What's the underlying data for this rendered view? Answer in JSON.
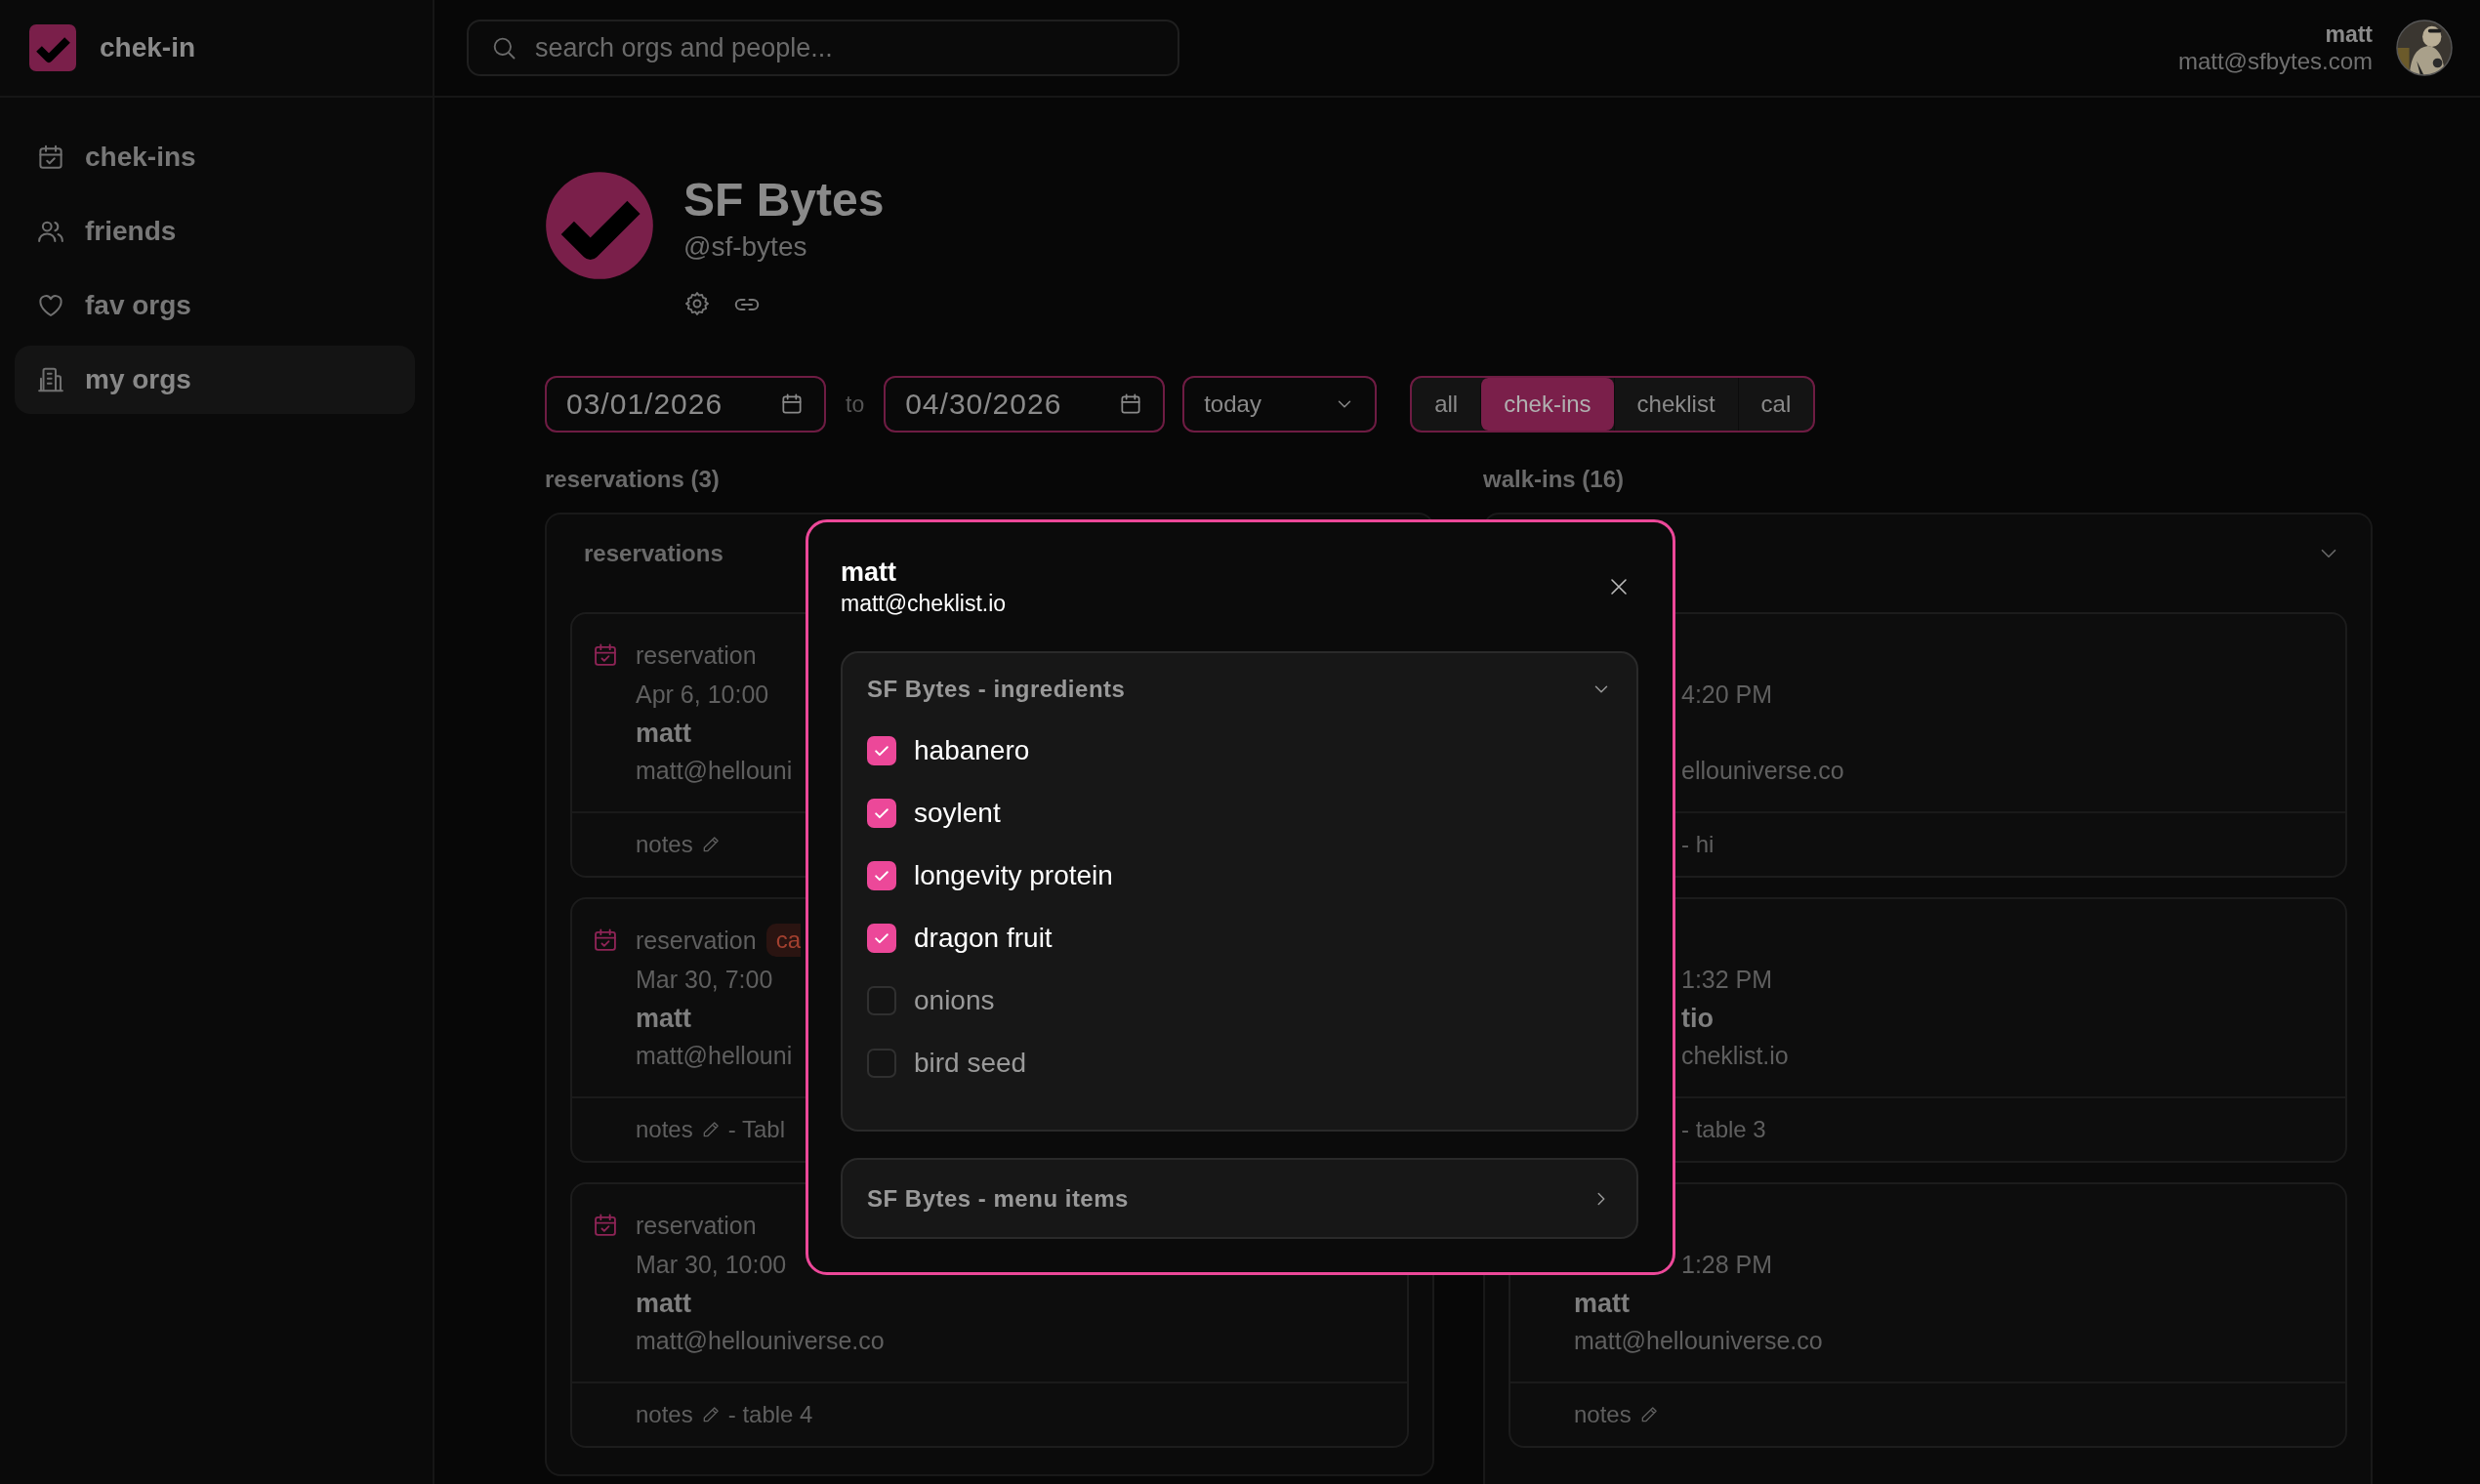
{
  "app": {
    "name": "chek-in"
  },
  "search": {
    "placeholder": "search orgs and people..."
  },
  "user": {
    "name": "matt",
    "email": "matt@sfbytes.com"
  },
  "sidebar": {
    "items": [
      {
        "label": "chek-ins",
        "kind": "calendar",
        "selected": false
      },
      {
        "label": "friends",
        "kind": "people",
        "selected": false
      },
      {
        "label": "fav orgs",
        "kind": "heart",
        "selected": false
      },
      {
        "label": "my orgs",
        "kind": "building",
        "selected": true
      }
    ]
  },
  "org": {
    "name": "SF Bytes",
    "handle": "@sf-bytes"
  },
  "filters": {
    "from": "03/01/2026",
    "separator": "to",
    "to": "04/30/2026",
    "range": "today",
    "views": [
      {
        "label": "all",
        "selected": false
      },
      {
        "label": "chek-ins",
        "selected": true
      },
      {
        "label": "cheklist",
        "selected": false
      },
      {
        "label": "cal",
        "selected": false
      }
    ]
  },
  "reservations": {
    "heading": "reservations (3)",
    "title": "reservations",
    "cards": [
      {
        "type": "reservation",
        "time": "Apr 6, 10:00",
        "name": "matt",
        "email": "matt@hellouni",
        "notes": "notes"
      },
      {
        "type": "reservation",
        "badge": "ca",
        "time": "Mar 30, 7:00",
        "name": "matt",
        "email": "matt@hellouni",
        "notes": "notes",
        "detail": "- Tabl"
      },
      {
        "type": "reservation",
        "time": "Mar 30, 10:00",
        "name": "matt",
        "email": "matt@hellouniverse.co",
        "notes": "notes",
        "detail": "- table 4"
      }
    ]
  },
  "walk_ins": {
    "heading": "walk-ins (16)",
    "expanded": true,
    "cards": [
      {
        "time": "4:20 PM",
        "email": "ellouniverse.co",
        "detail": "- hi"
      },
      {
        "time": "1:32 PM",
        "name": "tio",
        "email": "cheklist.io",
        "detail": "- table 3"
      },
      {
        "time": "1:28 PM",
        "name": "matt",
        "email": "matt@hellouniverse.co",
        "notes": "notes"
      }
    ]
  },
  "modal": {
    "name": "matt",
    "email": "matt@cheklist.io",
    "lists": [
      {
        "title": "SF Bytes - ingredients",
        "expanded": true,
        "items": [
          {
            "label": "habanero",
            "checked": true
          },
          {
            "label": "soylent",
            "checked": true
          },
          {
            "label": "longevity protein",
            "checked": true
          },
          {
            "label": "dragon fruit",
            "checked": true
          },
          {
            "label": "onions",
            "checked": false
          },
          {
            "label": "bird seed",
            "checked": false
          }
        ]
      },
      {
        "title": "SF Bytes - menu items",
        "expanded": false
      }
    ]
  }
}
